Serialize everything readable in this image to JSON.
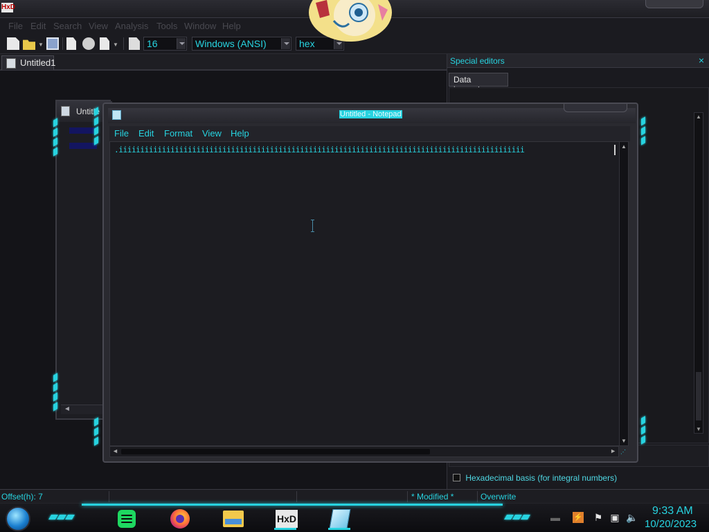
{
  "hxd": {
    "app_icon": "HxD",
    "menu": [
      "File",
      "Edit",
      "Search",
      "View",
      "Analysis",
      "Tools",
      "Window",
      "Help"
    ],
    "toolbar": {
      "bytes_per_row": "16",
      "charset": "Windows (ANSI)",
      "offset_base": "hex"
    },
    "document_tab": "Untitled1",
    "inner_window_title": "Untitle",
    "special_editors": {
      "header": "Special editors",
      "close": "×",
      "tab": "Data inspector",
      "hex_basis_label": "Hexadecimal basis (for integral numbers)"
    },
    "status": {
      "offset": "Offset(h): 7",
      "modified": "* Modified *",
      "mode": "Overwrite"
    }
  },
  "notepad": {
    "title": "Untitled - Notepad",
    "menu": [
      "File",
      "Edit",
      "Format",
      "View",
      "Help"
    ],
    "content": ".iiiiiiiiiiiiiiiiiiiiiiiiiiiiiiiiiiiiiiiiiiiiiiiiiiiiiiiiiiiiiiiiiiiiiiiiiiiiiiiiiiiiiiiiiiiiii"
  },
  "taskbar": {
    "apps": [
      "spotify-icon",
      "firefox-icon",
      "file-explorer-icon",
      "hxd-icon",
      "notepad-icon"
    ],
    "hxd_label": "HxD",
    "tray_app_glyph": "⚡",
    "time": "9:33 AM",
    "date": "10/20/2023"
  },
  "colors": {
    "accent": "#27d3e0",
    "background": "#121216",
    "panel": "#1d1d22"
  }
}
